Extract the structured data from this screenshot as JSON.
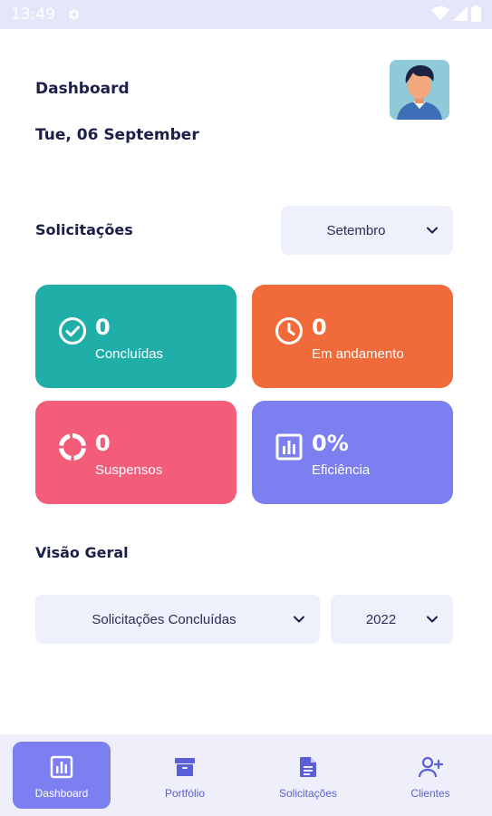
{
  "status_bar": {
    "time": "13:49"
  },
  "header": {
    "title": "Dashboard",
    "date": "Tue, 06 September"
  },
  "requests": {
    "title": "Solicitações",
    "month_select": "Setembro",
    "cards": [
      {
        "value": "0",
        "label": "Concluídas",
        "color": "#1fafa8",
        "icon": "check-circle-icon"
      },
      {
        "value": "0",
        "label": "Em andamento",
        "color": "#f06a3a",
        "icon": "clock-icon"
      },
      {
        "value": "0",
        "label": "Suspensos",
        "color": "#f45d7a",
        "icon": "progress-ring-icon"
      },
      {
        "value": "0%",
        "label": "Eficiência",
        "color": "#7b7ff0",
        "icon": "bar-chart-icon"
      }
    ]
  },
  "overview": {
    "title": "Visão Geral",
    "type_select": "Solicitações Concluídas",
    "year_select": "2022"
  },
  "bottom_nav": [
    {
      "label": "Dashboard",
      "icon": "dashboard-icon",
      "active": true
    },
    {
      "label": "Portfólio",
      "icon": "archive-icon",
      "active": false
    },
    {
      "label": "Solicitações",
      "icon": "document-icon",
      "active": false
    },
    {
      "label": "Clientes",
      "icon": "add-user-icon",
      "active": false
    }
  ]
}
